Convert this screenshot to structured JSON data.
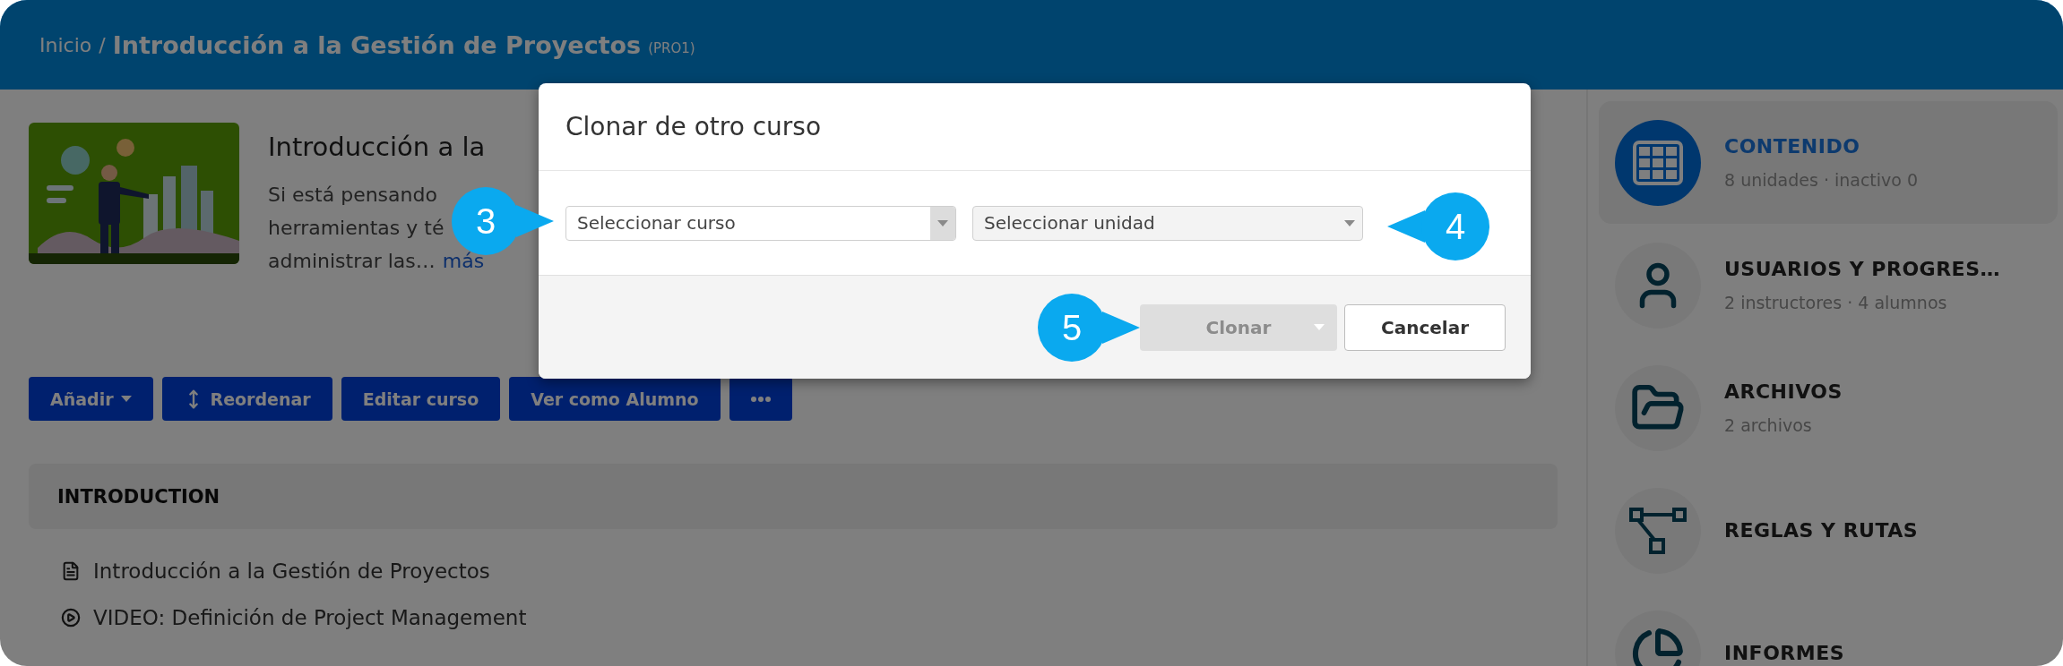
{
  "breadcrumb": {
    "home": "Inicio",
    "separator": "/",
    "current": "Introducción a la Gestión de Proyectos",
    "code": "(PRO1)"
  },
  "course": {
    "title": "Introducción a la",
    "description_lines": [
      "Si está pensando",
      "herramientas y té",
      "administrar las…"
    ],
    "more_link": "más"
  },
  "toolbar": [
    {
      "kind": "dropdown",
      "label": "Añadir"
    },
    {
      "kind": "reorder",
      "label": "Reordenar"
    },
    {
      "kind": "plain",
      "label": "Editar curso"
    },
    {
      "kind": "plain",
      "label": "Ver como Alumno"
    },
    {
      "kind": "more"
    }
  ],
  "section": {
    "title": "INTRODUCTION",
    "items": [
      {
        "kind": "document",
        "label": "Introducción a la Gestión de Proyectos"
      },
      {
        "kind": "video",
        "label": "VIDEO: Definición de Project Management"
      }
    ]
  },
  "sidebar": {
    "items": [
      {
        "kind": "content",
        "title": "CONTENIDO",
        "subtitle": "8 unidades · inactivo 0",
        "selected": true
      },
      {
        "kind": "users",
        "title": "USUARIOS Y PROGRES…",
        "subtitle": "2 instructores · 4 alumnos",
        "selected": false
      },
      {
        "kind": "files",
        "title": "ARCHIVOS",
        "subtitle": "2 archivos",
        "selected": false
      },
      {
        "kind": "rules",
        "title": "REGLAS Y RUTAS",
        "selected": false
      },
      {
        "kind": "reports",
        "title": "INFORMES",
        "selected": false
      }
    ]
  },
  "modal": {
    "title": "Clonar de otro curso",
    "selects": [
      {
        "placeholder": "Seleccionar curso",
        "disabled": false
      },
      {
        "placeholder": "Seleccionar unidad",
        "disabled": true
      }
    ],
    "buttons": [
      {
        "kind": "split",
        "label": "Clonar",
        "disabled": true
      },
      {
        "kind": "plain",
        "label": "Cancelar",
        "disabled": false
      }
    ]
  },
  "callouts": [
    {
      "number": "3",
      "kind": "pointing-right"
    },
    {
      "number": "4",
      "kind": "pointing-left"
    },
    {
      "number": "5",
      "kind": "pointing-right"
    }
  ]
}
